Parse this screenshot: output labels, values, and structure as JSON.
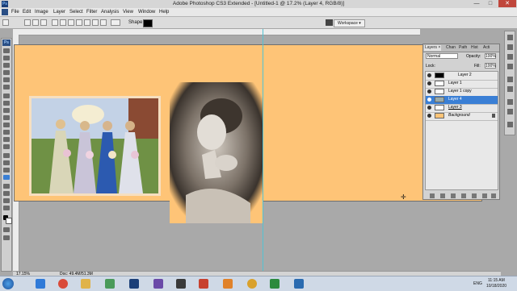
{
  "window": {
    "logo": "Ps",
    "title": "Adobe Photoshop CS3 Extended - [Untitled-1 @ 17.2% (Layer 4, RGB/8)]",
    "minimize": "—",
    "maximize": "□",
    "close": "✕"
  },
  "menu": [
    "File",
    "Edit",
    "Image",
    "Layer",
    "Select",
    "Filter",
    "Analysis",
    "View",
    "Window",
    "Help"
  ],
  "options_bar": {
    "shape_label": "Shape:",
    "workspace_label": "Workspace ▾"
  },
  "toolbox": {
    "badge": "Ps"
  },
  "layers_panel": {
    "tabs": [
      "Layers ×",
      "Chan",
      "Path",
      "Hist",
      "Acti"
    ],
    "blend_mode": "Normal",
    "opacity_label": "Opacity:",
    "opacity_value": "100%",
    "lock_label": "Lock:",
    "fill_label": "Fill:",
    "fill_value": "100%",
    "layers": [
      {
        "name": "Layer 2",
        "selected": false
      },
      {
        "name": "Layer 1",
        "selected": false
      },
      {
        "name": "Layer 1 copy",
        "selected": false
      },
      {
        "name": "Layer 4",
        "selected": true
      },
      {
        "name": "Layer 3",
        "selected": false
      },
      {
        "name": "Background",
        "selected": false
      }
    ]
  },
  "status": {
    "zoom": "17.15%",
    "doc": "Doc: 49.4M/51.3M"
  },
  "taskbar": {
    "lang": "ENG",
    "time": "11:15 AM",
    "date": "10/18/2020"
  },
  "colors": {
    "canvas_bg": "#fec477",
    "selected_layer": "#3a7fd5",
    "guide": "#53c3d2"
  }
}
